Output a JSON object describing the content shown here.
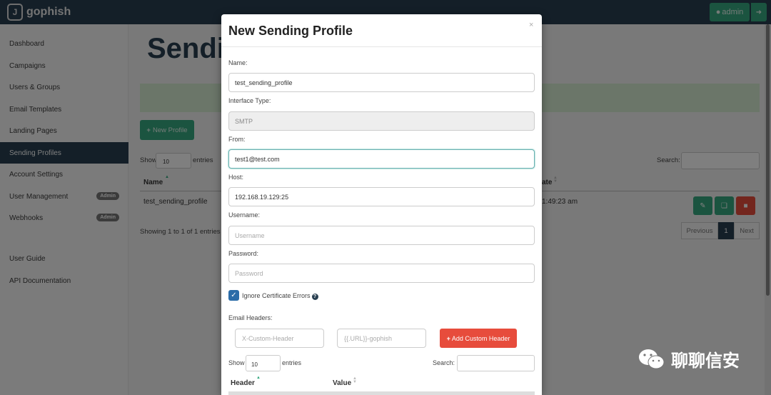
{
  "brand": {
    "name": "gophish"
  },
  "topbar": {
    "admin_label": "admin"
  },
  "sidebar": {
    "items": [
      {
        "label": "Dashboard"
      },
      {
        "label": "Campaigns"
      },
      {
        "label": "Users & Groups"
      },
      {
        "label": "Email Templates"
      },
      {
        "label": "Landing Pages"
      },
      {
        "label": "Sending Profiles"
      },
      {
        "label": "Account Settings"
      },
      {
        "label": "User Management",
        "badge": "Admin"
      },
      {
        "label": "Webhooks",
        "badge": "Admin"
      },
      {
        "label": "User Guide"
      },
      {
        "label": "API Documentation"
      }
    ],
    "active": "Sending Profiles"
  },
  "main": {
    "title": "Sendi",
    "new_profile": "New Profile",
    "show": "Show",
    "entries_value": "10",
    "entries": "entries",
    "search": "Search:",
    "columns": [
      "Name",
      "ate"
    ],
    "rows": [
      {
        "name": "test_sending_profile",
        "date": "1:49:23 am"
      }
    ],
    "showing": "Showing 1 to 1 of 1 entries",
    "pagination": {
      "previous": "Previous",
      "page": "1",
      "next": "Next"
    }
  },
  "modal": {
    "title": "New Sending Profile",
    "close": "×",
    "name_label": "Name:",
    "name_value": "test_sending_profile",
    "interface_label": "Interface Type:",
    "interface_value": "SMTP",
    "from_label": "From:",
    "from_value": "test1@test.com",
    "host_label": "Host:",
    "host_value": "192.168.19.129:25",
    "username_label": "Username:",
    "username_placeholder": "Username",
    "password_label": "Password:",
    "password_placeholder": "Password",
    "ignore_cert_label": "Ignore Certificate Errors",
    "ignore_cert_checked": true,
    "headers_label": "Email Headers:",
    "header_placeholder": "X-Custom-Header",
    "value_placeholder": "{{.URL}}-gophish",
    "add_header": "Add Custom Header",
    "show": "Show",
    "entries_value": "10",
    "entries": "entries",
    "search": "Search:",
    "columns": [
      "Header",
      "Value"
    ]
  },
  "watermark": {
    "text": "聊聊信安"
  },
  "colors": {
    "nav_dark": "#283f50",
    "success": "#36a981",
    "danger": "#e74c3c",
    "primary": "#2b6ca8"
  }
}
